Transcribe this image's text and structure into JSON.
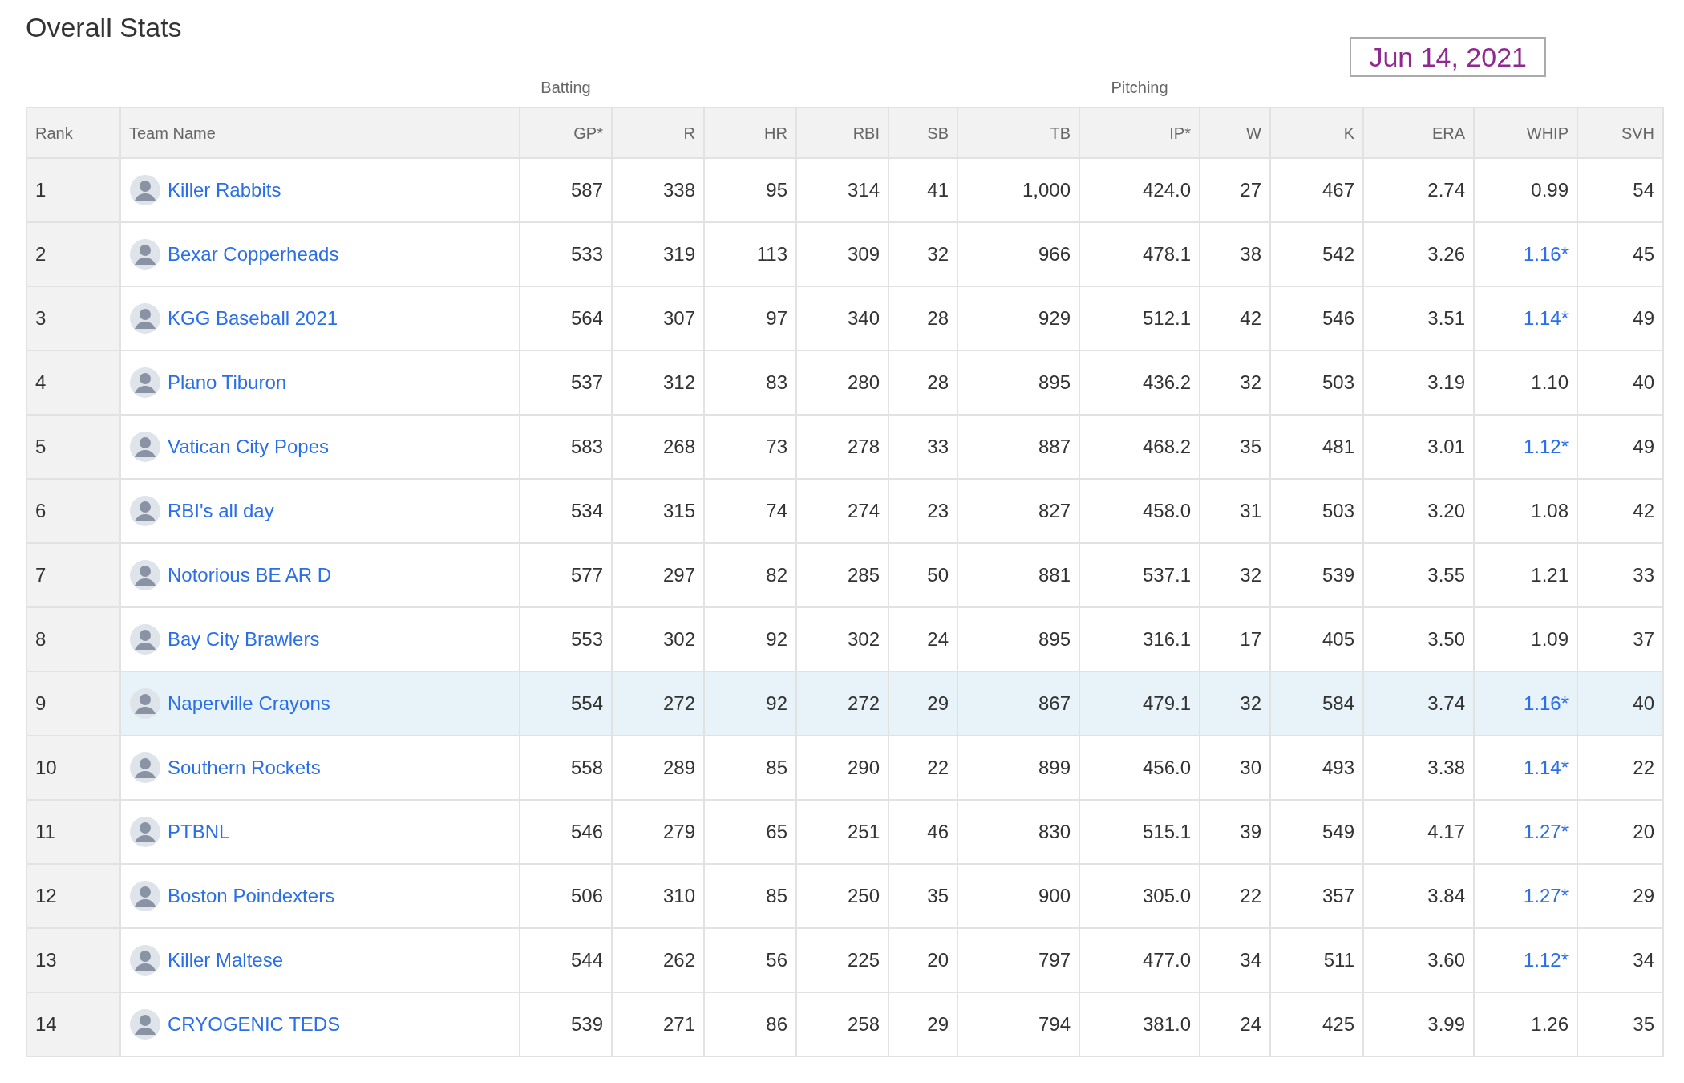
{
  "title": "Overall Stats",
  "date": "Jun 14, 2021",
  "groups": [
    "Batting",
    "Pitching"
  ],
  "columns": [
    {
      "label": "Rank",
      "kind": "rank"
    },
    {
      "label": "Team Name",
      "kind": "team"
    },
    {
      "label": "GP*",
      "kind": "stat"
    },
    {
      "label": "R",
      "kind": "stat"
    },
    {
      "label": "HR",
      "kind": "stat"
    },
    {
      "label": "RBI",
      "kind": "stat"
    },
    {
      "label": "SB",
      "kind": "stat"
    },
    {
      "label": "TB",
      "kind": "stat"
    },
    {
      "label": "IP*",
      "kind": "stat"
    },
    {
      "label": "W",
      "kind": "stat"
    },
    {
      "label": "K",
      "kind": "stat"
    },
    {
      "label": "ERA",
      "kind": "stat"
    },
    {
      "label": "WHIP",
      "kind": "whip"
    },
    {
      "label": "SVH",
      "kind": "stat"
    }
  ],
  "rows": [
    {
      "rank": "1",
      "team": "Killer Rabbits",
      "selected": false,
      "whip_is_link": false,
      "stats": [
        "587",
        "338",
        "95",
        "314",
        "41",
        "1,000",
        "424.0",
        "27",
        "467",
        "2.74",
        "0.99",
        "54"
      ]
    },
    {
      "rank": "2",
      "team": "Bexar Copperheads",
      "selected": false,
      "whip_is_link": true,
      "stats": [
        "533",
        "319",
        "113",
        "309",
        "32",
        "966",
        "478.1",
        "38",
        "542",
        "3.26",
        "1.16*",
        "45"
      ]
    },
    {
      "rank": "3",
      "team": "KGG Baseball 2021",
      "selected": false,
      "whip_is_link": true,
      "stats": [
        "564",
        "307",
        "97",
        "340",
        "28",
        "929",
        "512.1",
        "42",
        "546",
        "3.51",
        "1.14*",
        "49"
      ]
    },
    {
      "rank": "4",
      "team": "Plano Tiburon",
      "selected": false,
      "whip_is_link": false,
      "stats": [
        "537",
        "312",
        "83",
        "280",
        "28",
        "895",
        "436.2",
        "32",
        "503",
        "3.19",
        "1.10",
        "40"
      ]
    },
    {
      "rank": "5",
      "team": "Vatican City Popes",
      "selected": false,
      "whip_is_link": true,
      "stats": [
        "583",
        "268",
        "73",
        "278",
        "33",
        "887",
        "468.2",
        "35",
        "481",
        "3.01",
        "1.12*",
        "49"
      ]
    },
    {
      "rank": "6",
      "team": "RBI's all day",
      "selected": false,
      "whip_is_link": false,
      "stats": [
        "534",
        "315",
        "74",
        "274",
        "23",
        "827",
        "458.0",
        "31",
        "503",
        "3.20",
        "1.08",
        "42"
      ]
    },
    {
      "rank": "7",
      "team": "Notorious BE AR D",
      "selected": false,
      "whip_is_link": false,
      "stats": [
        "577",
        "297",
        "82",
        "285",
        "50",
        "881",
        "537.1",
        "32",
        "539",
        "3.55",
        "1.21",
        "33"
      ]
    },
    {
      "rank": "8",
      "team": "Bay City Brawlers",
      "selected": false,
      "whip_is_link": false,
      "stats": [
        "553",
        "302",
        "92",
        "302",
        "24",
        "895",
        "316.1",
        "17",
        "405",
        "3.50",
        "1.09",
        "37"
      ]
    },
    {
      "rank": "9",
      "team": "Naperville Crayons",
      "selected": true,
      "whip_is_link": true,
      "stats": [
        "554",
        "272",
        "92",
        "272",
        "29",
        "867",
        "479.1",
        "32",
        "584",
        "3.74",
        "1.16*",
        "40"
      ]
    },
    {
      "rank": "10",
      "team": "Southern Rockets",
      "selected": false,
      "whip_is_link": true,
      "stats": [
        "558",
        "289",
        "85",
        "290",
        "22",
        "899",
        "456.0",
        "30",
        "493",
        "3.38",
        "1.14*",
        "22"
      ]
    },
    {
      "rank": "11",
      "team": "PTBNL",
      "selected": false,
      "whip_is_link": true,
      "stats": [
        "546",
        "279",
        "65",
        "251",
        "46",
        "830",
        "515.1",
        "39",
        "549",
        "4.17",
        "1.27*",
        "20"
      ]
    },
    {
      "rank": "12",
      "team": "Boston Poindexters",
      "selected": false,
      "whip_is_link": true,
      "stats": [
        "506",
        "310",
        "85",
        "250",
        "35",
        "900",
        "305.0",
        "22",
        "357",
        "3.84",
        "1.27*",
        "29"
      ]
    },
    {
      "rank": "13",
      "team": "Killer Maltese",
      "selected": false,
      "whip_is_link": true,
      "stats": [
        "544",
        "262",
        "56",
        "225",
        "20",
        "797",
        "477.0",
        "34",
        "511",
        "3.60",
        "1.12*",
        "34"
      ]
    },
    {
      "rank": "14",
      "team": "CRYOGENIC TEDS",
      "selected": false,
      "whip_is_link": false,
      "stats": [
        "539",
        "271",
        "86",
        "258",
        "29",
        "794",
        "381.0",
        "24",
        "425",
        "3.99",
        "1.26",
        "35"
      ]
    }
  ]
}
